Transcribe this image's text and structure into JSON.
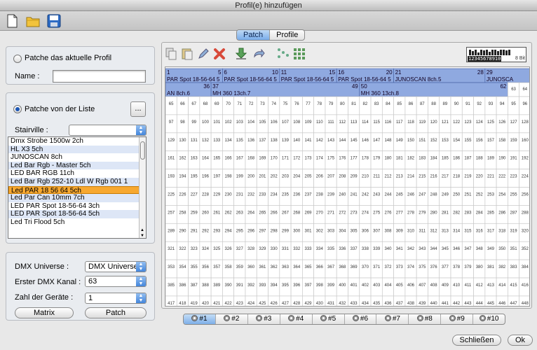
{
  "window": {
    "title": "Profil(e) hinzufügen"
  },
  "toolbar": {
    "icons": [
      "new-file-icon",
      "open-folder-icon",
      "save-disk-icon"
    ]
  },
  "tabs": [
    {
      "label": "Patch",
      "active": true
    },
    {
      "label": "Profile",
      "active": false
    }
  ],
  "profile_group": {
    "radio_label": "Patche das aktuelle Profil",
    "name_label": "Name :",
    "name_value": ""
  },
  "list_group": {
    "radio_label": "Patche von der Liste",
    "browse_label": "...",
    "manufacturer_label": "Stairville :",
    "manufacturer_value": "",
    "items": [
      "Dmx Strobe 1500w 2ch",
      "HL X3 5ch",
      "JUNOSCAN 8ch",
      "Led Bar Rgb - Master 5ch",
      "LED BAR RGB 11ch",
      "Led Bar Rgb 252-10 Ldl W Rgb 001 1",
      "Led PAR 18 56 64  5ch",
      "Led Par Can 10mm 7ch",
      "LED PAR Spot 18-56-64 3ch",
      "LED PAR Spot 18-56-64 5ch",
      "Led Tri Flood 5ch"
    ],
    "selected_index": 6
  },
  "dmx_group": {
    "universe_label": "DMX Universe :",
    "universe_value": "DMX Universe",
    "channel_label": "Erster DMX Kanal :",
    "channel_value": "63",
    "count_label": "Zahl der Geräte :",
    "count_value": "1",
    "matrix_label": "Matrix",
    "patch_label": "Patch"
  },
  "right_toolbar": {
    "icons": [
      "copy-icon",
      "paste-icon",
      "edit-pencil-icon",
      "delete-x-icon",
      "download-arrow-icon",
      "redo-arrow-icon",
      "dots-pattern-icon",
      "grid-pattern-icon"
    ]
  },
  "meter": {
    "label": "12345678910",
    "bits": "8 Bit"
  },
  "patch_grid": {
    "row1": [
      {
        "start": "1",
        "end": "5",
        "label": "PAR Spot 18-56-64 5"
      },
      {
        "start": "6",
        "end": "10",
        "label": "PAR Spot 18-56-64 5"
      },
      {
        "start": "11",
        "end": "15",
        "label": "PAR Spot 18-56-64 5"
      },
      {
        "start": "16",
        "end": "20",
        "label": "PAR Spot 18-56-64 5"
      },
      {
        "start": "21",
        "end": "28",
        "label": "JUNOSCAN 8ch.5"
      },
      {
        "start": "29",
        "end": "",
        "label": "JUNOSCA"
      }
    ],
    "row2": [
      {
        "start": "",
        "end": "36",
        "label": "AN 8ch.6"
      },
      {
        "start": "37",
        "end": "49",
        "label": "MH 360 13ch.7"
      },
      {
        "start": "50",
        "end": "62",
        "label": "MH 360 13ch.8"
      }
    ],
    "free_start": 63,
    "free_end": 512,
    "columns": 32
  },
  "pages": [
    "#1",
    "#2",
    "#3",
    "#4",
    "#5",
    "#6",
    "#7",
    "#8",
    "#9",
    "#10"
  ],
  "buttons": {
    "close": "Schließen",
    "ok": "Ok"
  }
}
